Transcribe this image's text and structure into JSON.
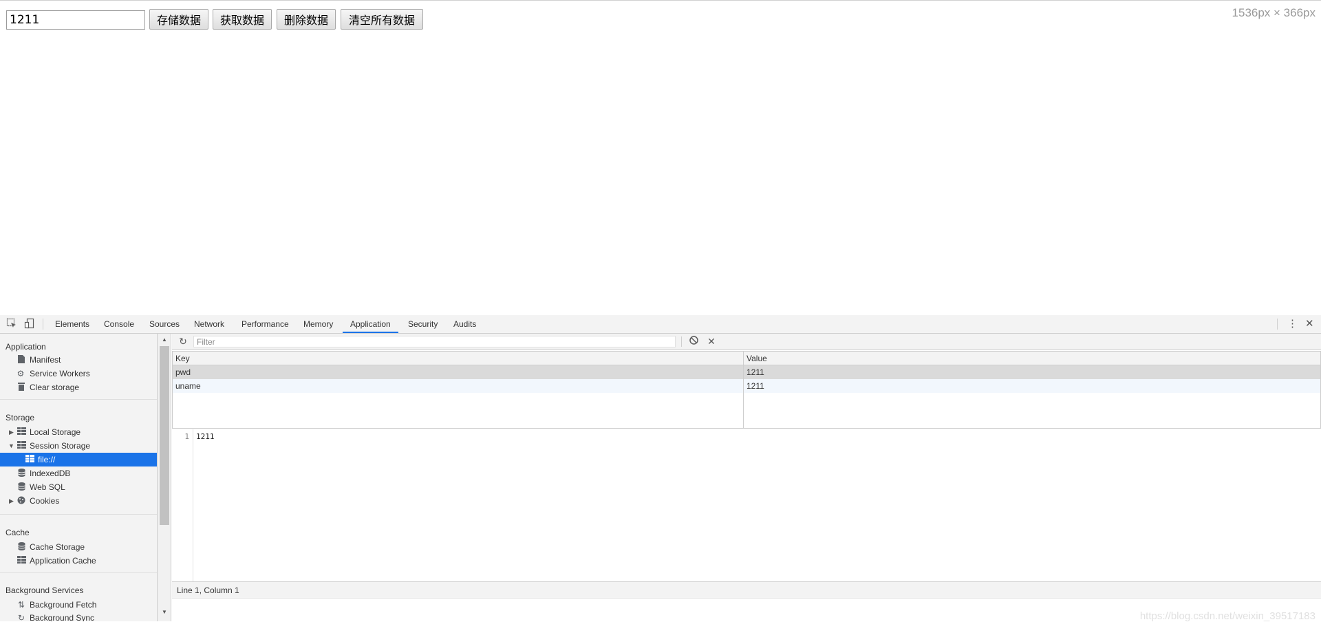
{
  "page": {
    "input_value": "1211",
    "buttons": [
      "存储数据",
      "获取数据",
      "删除数据",
      "清空所有数据"
    ],
    "dimensions": "1536px × 366px"
  },
  "devtools": {
    "tabs": [
      "Elements",
      "Console",
      "Sources",
      "Network",
      "Performance",
      "Memory",
      "Application",
      "Security",
      "Audits"
    ],
    "active_tab": "Application",
    "sidebar": {
      "application_header": "Application",
      "application_items": [
        "Manifest",
        "Service Workers",
        "Clear storage"
      ],
      "storage_header": "Storage",
      "storage_items": [
        "Local Storage",
        "Session Storage",
        "file://",
        "IndexedDB",
        "Web SQL",
        "Cookies"
      ],
      "cache_header": "Cache",
      "cache_items": [
        "Cache Storage",
        "Application Cache"
      ],
      "background_header": "Background Services",
      "background_items": [
        "Background Fetch",
        "Background Sync"
      ]
    },
    "toolbar": {
      "filter_placeholder": "Filter"
    },
    "table": {
      "columns": [
        "Key",
        "Value"
      ],
      "rows": [
        {
          "key": "pwd",
          "value": "1211"
        },
        {
          "key": "uname",
          "value": "1211"
        }
      ]
    },
    "editor": {
      "line_number": "1",
      "line_text": "1211"
    },
    "status": "Line 1, Column 1",
    "watermark": "https://blog.csdn.net/weixin_39517183"
  },
  "colors": {
    "accent": "#1a73e8",
    "selected_row": "#dadada",
    "panel_bg": "#f3f3f3"
  }
}
